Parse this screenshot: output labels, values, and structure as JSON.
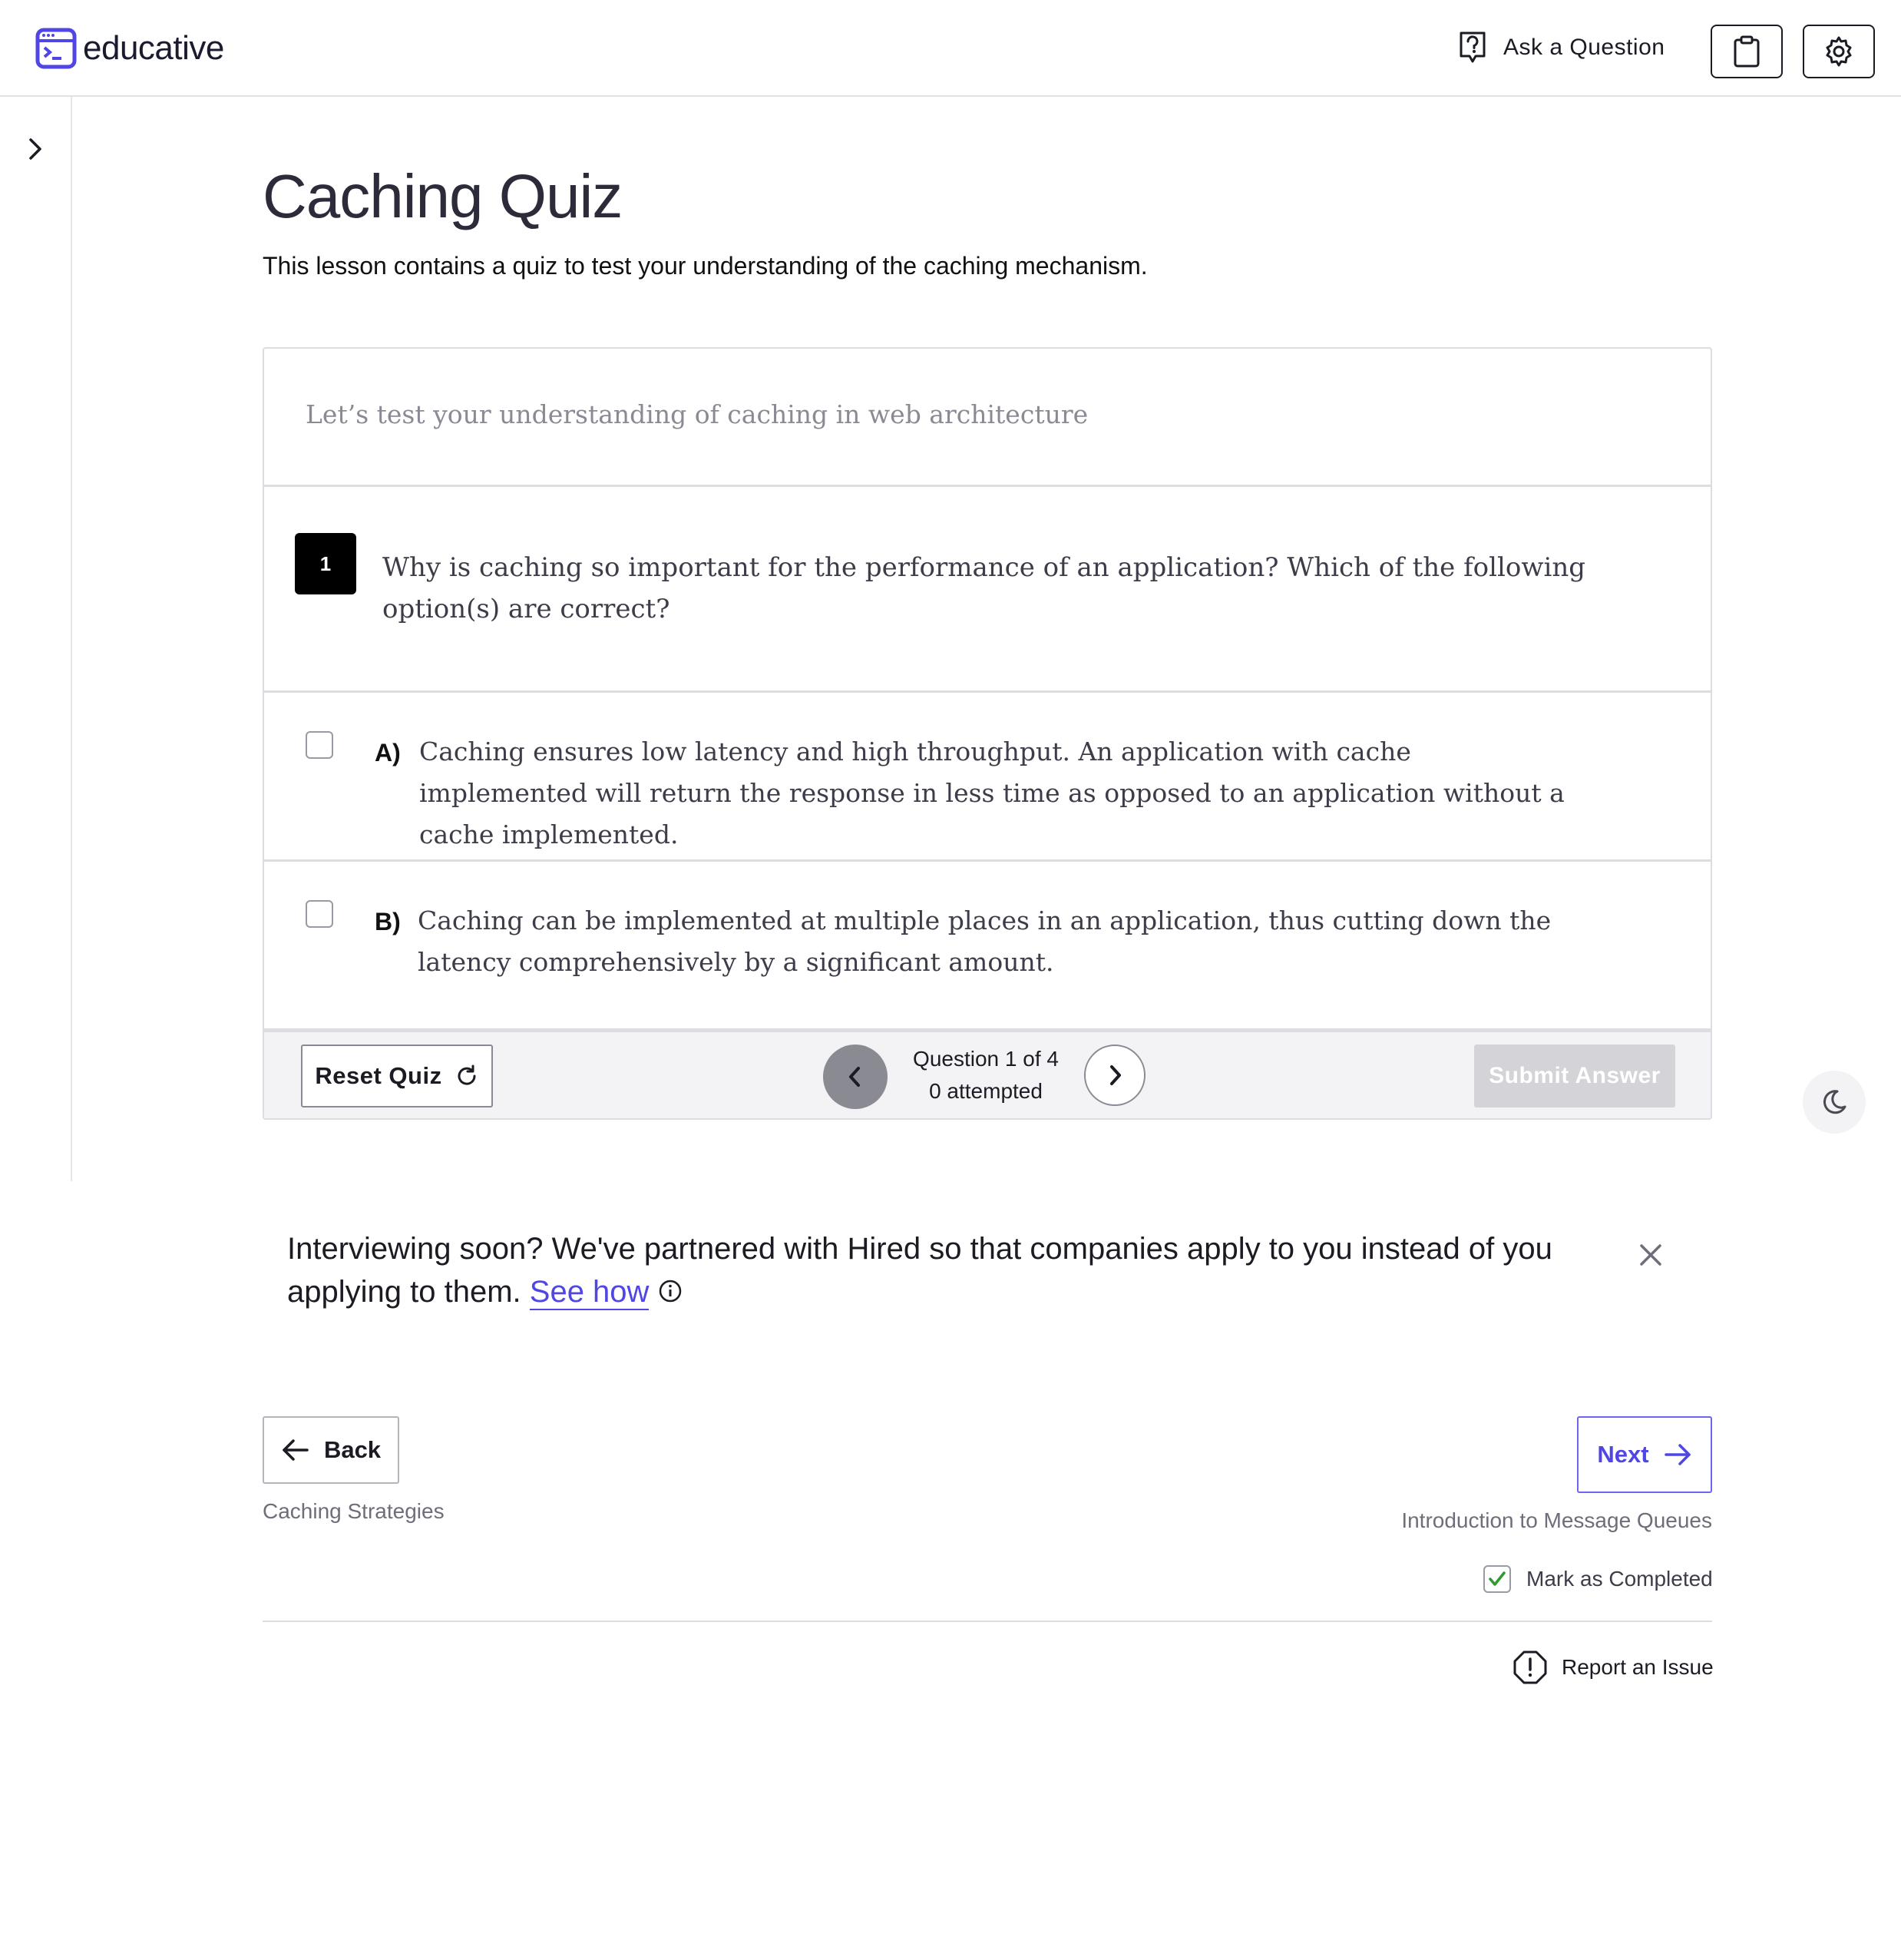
{
  "header": {
    "logo_text": "educative",
    "ask_label": "Ask a Question",
    "icons": [
      "help-icon",
      "clipboard-icon",
      "gear-icon"
    ]
  },
  "page": {
    "title": "Caching Quiz",
    "subtitle": "This lesson contains a quiz to test your understanding of the caching mechanism."
  },
  "quiz": {
    "intro": "Let’s test your understanding of caching in web architecture",
    "question_number": "1",
    "question_text": "Why is caching so important for the performance of an application? Which of the following option(s) are correct?",
    "options": [
      {
        "letter": "A)",
        "text": "Caching ensures low latency and high throughput. An application with cache implemented will return the response in less time as opposed to an application without a cache implemented."
      },
      {
        "letter": "B)",
        "text": "Caching can be implemented at multiple places in an application, thus cutting down the latency comprehensively by a significant amount."
      }
    ],
    "reset_label": "Reset Quiz",
    "counter_line1": "Question 1 of 4",
    "counter_line2": "0 attempted",
    "submit_label": "Submit Answer"
  },
  "promo": {
    "text": "Interviewing soon? We've partnered with Hired so that companies apply to you instead of you applying to them.",
    "link": "See how"
  },
  "navigation": {
    "back_label": "Back",
    "back_sub": "Caching Strategies",
    "next_label": "Next",
    "next_sub": "Introduction to Message Queues",
    "mark_label": "Mark as Completed",
    "report_label": "Report an Issue"
  },
  "colors": {
    "accent": "#4f46e5",
    "check_green": "#2e9a2e",
    "submit_disabled": "#d3d3d8"
  }
}
